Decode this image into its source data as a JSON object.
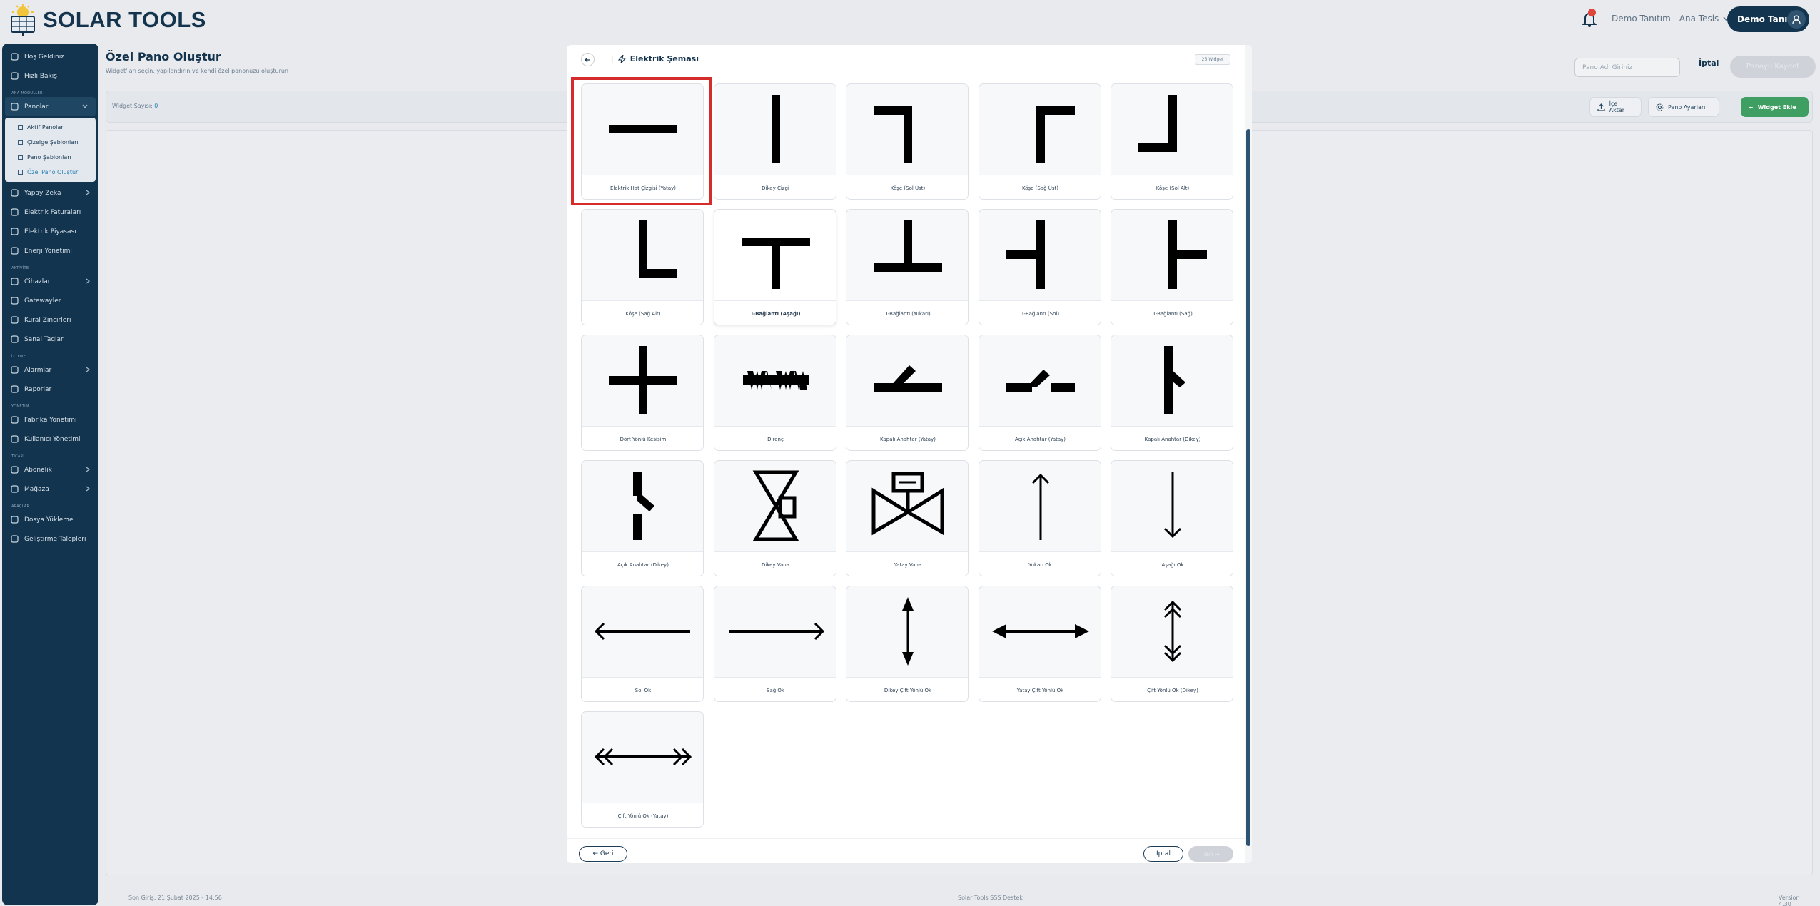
{
  "app": {
    "name": "SOLAR TOOLS",
    "tenant": "Demo Tanıtım - Ana Tesis",
    "user": "Demo Tanıtım"
  },
  "sidebar": {
    "top": [
      {
        "label": "Hoş Geldiniz",
        "icon": "star-icon"
      },
      {
        "label": "Hızlı Bakış",
        "icon": "grid-icon"
      }
    ],
    "sections": [
      {
        "title": "ANA MODÜLLER",
        "items": [
          {
            "label": "Panolar",
            "icon": "dashboard-icon",
            "open": true,
            "children": [
              {
                "label": "Aktif Panolar"
              },
              {
                "label": "Çizelge Şablonları"
              },
              {
                "label": "Pano Şablonları"
              },
              {
                "label": "Özel Pano Oluştur",
                "active": true
              }
            ]
          },
          {
            "label": "Yapay Zeka",
            "icon": "ai-icon",
            "chevron": true
          },
          {
            "label": "Elektrik Faturaları",
            "icon": "invoice-icon"
          },
          {
            "label": "Elektrik Piyasası",
            "icon": "market-icon"
          },
          {
            "label": "Enerji Yönetimi",
            "icon": "sliders-icon"
          }
        ]
      },
      {
        "title": "AKTİVİTE",
        "items": [
          {
            "label": "Cihazlar",
            "icon": "device-icon",
            "chevron": true
          },
          {
            "label": "Gatewayler",
            "icon": "gateway-icon"
          },
          {
            "label": "Kural Zincirleri",
            "icon": "chain-icon"
          },
          {
            "label": "Sanal Taglar",
            "icon": "pulse-icon"
          }
        ]
      },
      {
        "title": "İZLEME",
        "items": [
          {
            "label": "Alarmlar",
            "icon": "alarm-icon",
            "chevron": true
          },
          {
            "label": "Raporlar",
            "icon": "report-icon"
          }
        ]
      },
      {
        "title": "YÖNETİM",
        "items": [
          {
            "label": "Fabrika Yönetimi",
            "icon": "factory-icon"
          },
          {
            "label": "Kullanıcı Yönetimi",
            "icon": "users-icon"
          }
        ]
      },
      {
        "title": "TİCARİ",
        "items": [
          {
            "label": "Abonelik",
            "icon": "subscription-icon",
            "chevron": true
          },
          {
            "label": "Mağaza",
            "icon": "store-icon",
            "chevron": true
          }
        ]
      },
      {
        "title": "ARAÇLAR",
        "items": [
          {
            "label": "Dosya Yükleme",
            "icon": "upload-icon"
          },
          {
            "label": "Geliştirme Talepleri",
            "icon": "code-icon"
          }
        ]
      }
    ]
  },
  "page": {
    "title": "Özel Pano Oluştur",
    "subtitle": "Widget'ları seçin, yapılandırın ve kendi özel panonuzu oluşturun",
    "board_name_placeholder": "Pano Adı Giriniz",
    "cancel": "İptal",
    "save": "Panoyu Kaydet",
    "widget_count_label": "Widget Sayısı:",
    "widget_count": "0",
    "import": "İçe Aktar",
    "board_settings": "Pano Ayarları",
    "add_widget": "Widget Ekle"
  },
  "modal": {
    "title": "Elektrik Şeması",
    "count_badge": "26 Widget",
    "back": "← Geri",
    "cancel": "İptal",
    "next": "İleri →",
    "widgets": [
      "Elektrik Hat Çizgisi (Yatay)",
      "Dikey Çizgi",
      "Köşe (Sol Üst)",
      "Köşe (Sağ Üst)",
      "Köşe (Sol Alt)",
      "Köşe (Sağ Alt)",
      "T-Bağlantı (Aşağı)",
      "T-Bağlantı (Yukarı)",
      "T-Bağlantı (Sol)",
      "T-Bağlantı (Sağ)",
      "Dört Yönlü Kesişim",
      "Direnç",
      "Kapalı Anahtar (Yatay)",
      "Açık Anahtar (Yatay)",
      "Kapalı Anahtar (Dikey)",
      "Açık Anahtar (Dikey)",
      "Dikey Vana",
      "Yatay Vana",
      "Yukarı Ok",
      "Aşağı Ok",
      "Sol Ok",
      "Sağ Ok",
      "Dikey Çift Yönlü Ok",
      "Yatay Çift Yönlü Ok",
      "Çift Yönlü Ok (Dikey)",
      "Çift Yönlü Ok (Yatay)"
    ]
  },
  "footer": {
    "last_login": "Son Giriş: 21 Şubat 2025 - 14:56",
    "links": "Solar Tools   SSS   Destek",
    "version": "Version 4.30"
  },
  "colors": {
    "sidebar": "#13344f",
    "accent_green": "#3f9e62",
    "selection": "#d62b2b"
  }
}
